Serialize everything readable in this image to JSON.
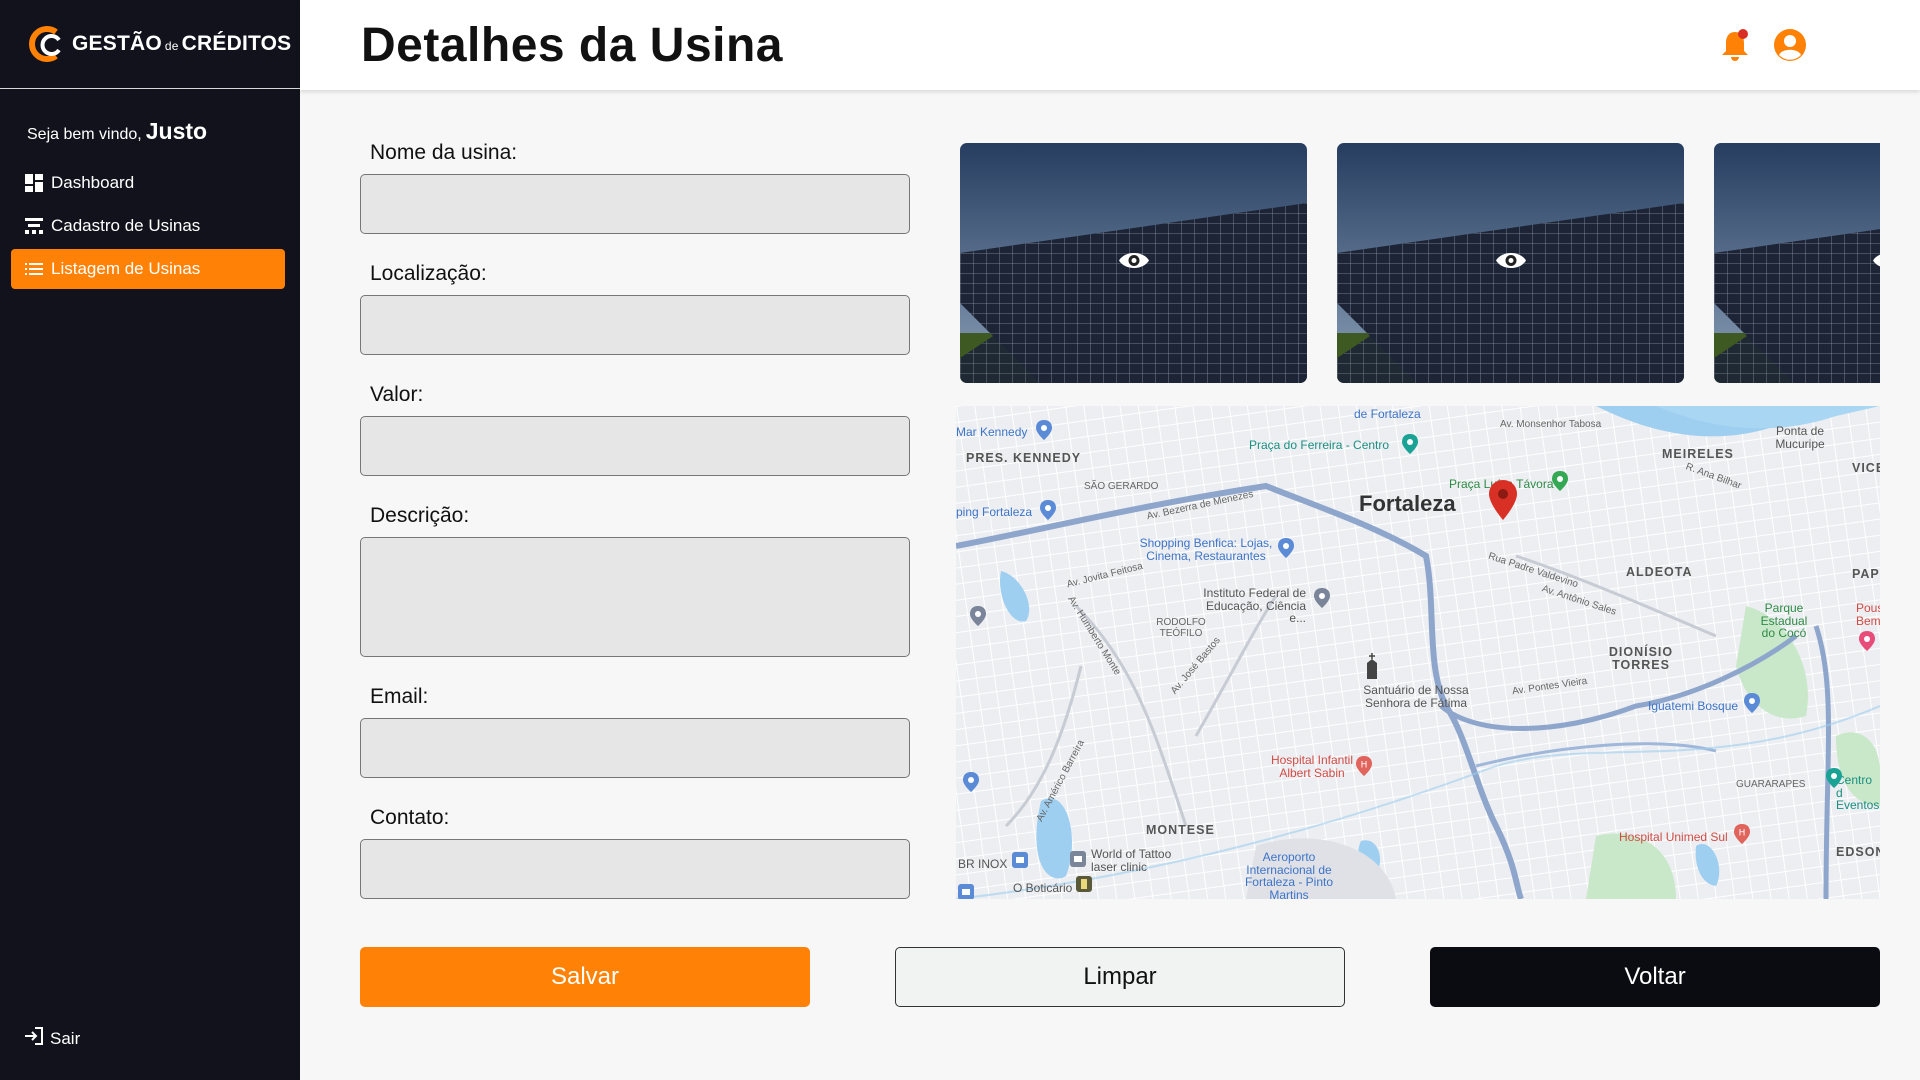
{
  "brand": {
    "logo_main": "GESTÃO",
    "logo_de": "de",
    "logo_end": "CRÉDITOS",
    "accent": "#ff8207"
  },
  "sidebar": {
    "welcome": "Seja bem vindo,",
    "user_name": "Justo",
    "items": [
      {
        "label": "Dashboard",
        "icon": "dashboard-icon",
        "active": false
      },
      {
        "label": "Cadastro de Usinas",
        "icon": "register-icon",
        "active": false
      },
      {
        "label": "Listagem de Usinas",
        "icon": "list-icon",
        "active": true
      }
    ],
    "logout": "Sair"
  },
  "header": {
    "title": "Detalhes da Usina",
    "notification_icon": "bell-icon",
    "profile_icon": "user-circle-icon"
  },
  "form": {
    "fields": [
      {
        "label": "Nome da usina:",
        "value": ""
      },
      {
        "label": "Localização:",
        "value": ""
      },
      {
        "label": "Valor:",
        "value": ""
      },
      {
        "label": "Descrição:",
        "value": ""
      },
      {
        "label": "Email:",
        "value": ""
      },
      {
        "label": "Contato:",
        "value": ""
      }
    ]
  },
  "gallery": {
    "image_count_visible": 3,
    "overlay_icon": "eye-icon"
  },
  "map": {
    "city": "Fortaleza",
    "districts": [
      "PRES. KENNEDY",
      "MEIRELES",
      "ALDEOTA",
      "DIONÍSIO TORRES",
      "MONTESE",
      "VICE",
      "PAPI",
      "EDSON"
    ],
    "small_districts": [
      "SÃO GERARDO",
      "RODOLFO TEÓFILO",
      "GUARARAPES"
    ],
    "pois": [
      "de Fortaleza",
      "Praça do Ferreira - Centro",
      "Av. Monsenhor Tabosa",
      "Ponta de Mucuripe",
      "Mar Kennedy",
      "Praça Luíza Távora",
      "ping Fortaleza",
      "Shopping Benfica: Lojas, Cinema, Restaurantes",
      "Instituto Federal de Educação, Ciência e...",
      "Parque Estadual do Cocó",
      "Santuário de Nossa Senhora de Fátima",
      "Iguatemi Bosque",
      "Hospital Infantil Albert Sabin",
      "Centro d Eventos",
      "Hospital Unimed Sul",
      "World of Tattoo laser clinic",
      "BR INOX",
      "O Boticário",
      "Aeroporto Internacional de Fortaleza - Pinto Martins",
      "Pous Bem"
    ],
    "streets": [
      "Av. Bezerra de Menezes",
      "Av. Jovita Feitosa",
      "Av. Humberto Monte",
      "Av. José Bastos",
      "Av. Américo Barreira",
      "Rua Padre Valdevino",
      "Av. Antônio Sales",
      "Av. Pontes Vieira",
      "R. Ana Bilhar"
    ],
    "marker_color": "#d93025"
  },
  "buttons": {
    "save": "Salvar",
    "clear": "Limpar",
    "back": "Voltar"
  }
}
